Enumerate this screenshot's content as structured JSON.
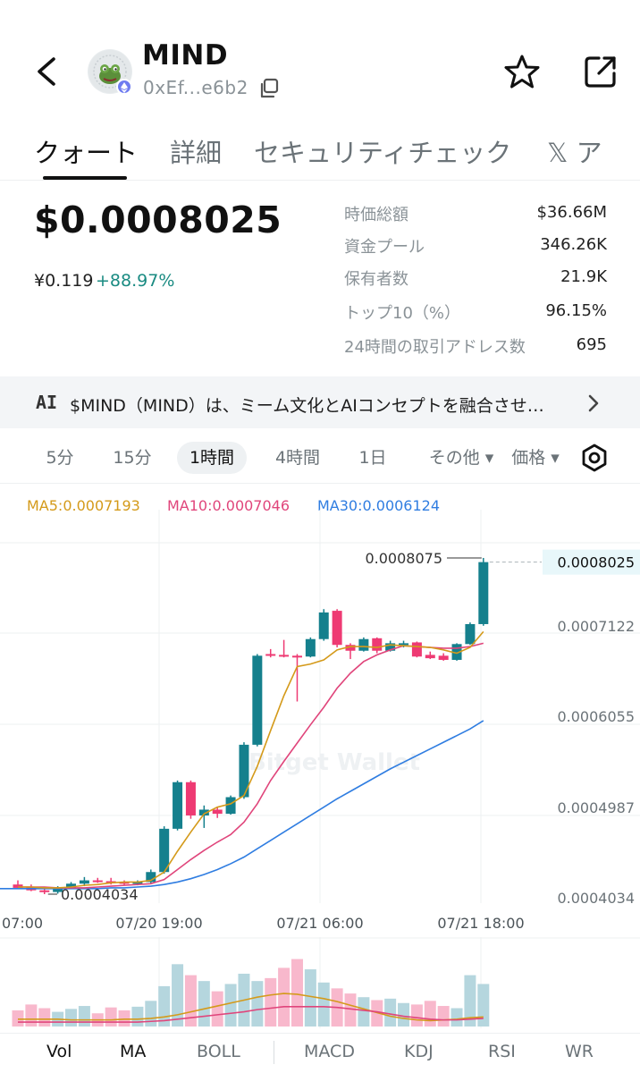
{
  "token": {
    "name": "MIND",
    "address": "0xEf...e6b2"
  },
  "tabs": [
    {
      "label": "クォート",
      "active": true
    },
    {
      "label": "詳細",
      "active": false
    },
    {
      "label": "セキュリティチェック",
      "active": false
    },
    {
      "label": "𝕏 ア",
      "active": false
    }
  ],
  "price": {
    "usd": "$0.0008025",
    "jpy": "¥0.119",
    "change": "+88.97%"
  },
  "stats": [
    {
      "label": "時価総額",
      "value": "$36.66M"
    },
    {
      "label": "資金プール",
      "value": "346.26K"
    },
    {
      "label": "保有者数",
      "value": "21.9K"
    },
    {
      "label": "トップ10（%）",
      "value": "96.15%"
    },
    {
      "label": "24時間の取引アドレス数",
      "value": "695"
    }
  ],
  "ai_banner": {
    "logo": "AI",
    "text": "$MIND（MIND）は、ミーム文化とAIコンセプトを融合させ…"
  },
  "timeframes": [
    {
      "label": "5分",
      "active": false
    },
    {
      "label": "15分",
      "active": false
    },
    {
      "label": "1時間",
      "active": true
    },
    {
      "label": "4時間",
      "active": false
    },
    {
      "label": "1日",
      "active": false
    },
    {
      "label": "その他 ▾",
      "active": false
    },
    {
      "label": "価格 ▾",
      "active": false
    }
  ],
  "ma_legend": {
    "ma5": "MA5:0.0007193",
    "ma10": "MA10:0.0007046",
    "ma30": "MA30:0.0006124"
  },
  "colors": {
    "up": "#15808d",
    "down": "#ee3a73",
    "ma5": "#d49a1a",
    "ma10": "#e0457b",
    "ma30": "#2f7de1",
    "accent_change": "#1a8b82"
  },
  "chart_data": {
    "type": "candlestick",
    "y_ticks": [
      "0.0008025",
      "0.0007122",
      "0.0006055",
      "0.0004987",
      "0.0004034"
    ],
    "x_ticks": [
      "07:00",
      "07/20 19:00",
      "07/21 06:00",
      "07/21 18:00"
    ],
    "high_label": "0.0008075",
    "low_label": "0.0004034",
    "current_price_label": "0.0008025",
    "watermark": "Bitget Wallet",
    "ylim": [
      0.0004034,
      0.0008075
    ],
    "candles": [
      {
        "o": 0.000415,
        "h": 0.00042,
        "l": 0.00041,
        "c": 0.000411
      },
      {
        "o": 0.000412,
        "h": 0.000415,
        "l": 0.000407,
        "c": 0.000408
      },
      {
        "o": 0.000408,
        "h": 0.000412,
        "l": 0.0004034,
        "c": 0.000406
      },
      {
        "o": 0.000406,
        "h": 0.000413,
        "l": 0.000404,
        "c": 0.000411
      },
      {
        "o": 0.000411,
        "h": 0.000418,
        "l": 0.00041,
        "c": 0.000416
      },
      {
        "o": 0.000416,
        "h": 0.000424,
        "l": 0.000413,
        "c": 0.00042
      },
      {
        "o": 0.00042,
        "h": 0.000423,
        "l": 0.000417,
        "c": 0.000419
      },
      {
        "o": 0.000419,
        "h": 0.000423,
        "l": 0.000415,
        "c": 0.000418
      },
      {
        "o": 0.000418,
        "h": 0.00042,
        "l": 0.000414,
        "c": 0.000416
      },
      {
        "o": 0.000416,
        "h": 0.00042,
        "l": 0.000414,
        "c": 0.000418
      },
      {
        "o": 0.000418,
        "h": 0.000433,
        "l": 0.000416,
        "c": 0.00043
      },
      {
        "o": 0.00043,
        "h": 0.000485,
        "l": 0.000428,
        "c": 0.000482
      },
      {
        "o": 0.000482,
        "h": 0.00054,
        "l": 0.00048,
        "c": 0.000538
      },
      {
        "o": 0.000538,
        "h": 0.00054,
        "l": 0.000494,
        "c": 0.000498
      },
      {
        "o": 0.000498,
        "h": 0.00051,
        "l": 0.000483,
        "c": 0.000505
      },
      {
        "o": 0.000505,
        "h": 0.000508,
        "l": 0.000495,
        "c": 0.0005
      },
      {
        "o": 0.0005,
        "h": 0.000522,
        "l": 0.000499,
        "c": 0.00052
      },
      {
        "o": 0.00052,
        "h": 0.000586,
        "l": 0.000518,
        "c": 0.000583
      },
      {
        "o": 0.000583,
        "h": 0.000692,
        "l": 0.000581,
        "c": 0.00069
      },
      {
        "o": 0.000692,
        "h": 0.000698,
        "l": 0.000688,
        "c": 0.000691
      },
      {
        "o": 0.000691,
        "h": 0.000709,
        "l": 0.000688,
        "c": 0.000689
      },
      {
        "o": 0.00069,
        "h": 0.000692,
        "l": 0.000635,
        "c": 0.000689
      },
      {
        "o": 0.000689,
        "h": 0.000712,
        "l": 0.000688,
        "c": 0.00071
      },
      {
        "o": 0.00071,
        "h": 0.000746,
        "l": 0.000708,
        "c": 0.000742
      },
      {
        "o": 0.000744,
        "h": 0.000746,
        "l": 0.0007,
        "c": 0.000703
      },
      {
        "o": 0.000703,
        "h": 0.000705,
        "l": 0.000686,
        "c": 0.000696
      },
      {
        "o": 0.000696,
        "h": 0.000712,
        "l": 0.000695,
        "c": 0.00071
      },
      {
        "o": 0.000711,
        "h": 0.000712,
        "l": 0.000693,
        "c": 0.000696
      },
      {
        "o": 0.000696,
        "h": 0.000708,
        "l": 0.000695,
        "c": 0.000705
      },
      {
        "o": 0.000704,
        "h": 0.000708,
        "l": 0.0007,
        "c": 0.000705
      },
      {
        "o": 0.000706,
        "h": 0.000707,
        "l": 0.000688,
        "c": 0.000689
      },
      {
        "o": 0.000691,
        "h": 0.000695,
        "l": 0.000686,
        "c": 0.000687
      },
      {
        "o": 0.00069,
        "h": 0.000693,
        "l": 0.000684,
        "c": 0.000685
      },
      {
        "o": 0.000685,
        "h": 0.000705,
        "l": 0.000684,
        "c": 0.000704
      },
      {
        "o": 0.000704,
        "h": 0.00073,
        "l": 0.000703,
        "c": 0.000728
      },
      {
        "o": 0.000728,
        "h": 0.0008075,
        "l": 0.000726,
        "c": 0.0008025
      }
    ],
    "ma5": [
      0.000412,
      0.000412,
      0.000411,
      0.000411,
      0.000412,
      0.000414,
      0.000415,
      0.000417,
      0.000418,
      0.000418,
      0.00042,
      0.00043,
      0.000455,
      0.000478,
      0.0005,
      0.000508,
      0.000512,
      0.000522,
      0.000557,
      0.0006,
      0.000642,
      0.000677,
      0.00068,
      0.000685,
      0.000697,
      0.000701,
      0.000701,
      0.0007,
      0.000703,
      0.000702,
      0.000701,
      0.0007,
      0.000697,
      0.000693,
      0.0007,
      0.000719
    ],
    "ma10": [
      0.000412,
      0.000412,
      0.000412,
      0.000411,
      0.000411,
      0.000411,
      0.000412,
      0.000413,
      0.000414,
      0.000415,
      0.000416,
      0.000421,
      0.000433,
      0.000445,
      0.000456,
      0.000466,
      0.000475,
      0.00049,
      0.000512,
      0.00054,
      0.000563,
      0.000585,
      0.000607,
      0.000628,
      0.000651,
      0.000669,
      0.000683,
      0.000691,
      0.000697,
      0.000702,
      0.000701,
      0.0007,
      0.000699,
      0.000699,
      0.000701,
      0.000705
    ],
    "ma30": [
      0.00041,
      0.00041,
      0.00041,
      0.00041,
      0.00041,
      0.00041,
      0.00041,
      0.000411,
      0.000411,
      0.000412,
      0.000413,
      0.000415,
      0.000418,
      0.000422,
      0.000427,
      0.000433,
      0.00044,
      0.000448,
      0.000458,
      0.000468,
      0.000478,
      0.000488,
      0.000498,
      0.000508,
      0.000518,
      0.000527,
      0.000536,
      0.000545,
      0.000554,
      0.000562,
      0.00057,
      0.000578,
      0.000586,
      0.000594,
      0.000602,
      0.000612
    ],
    "volume": [
      0.22,
      0.3,
      0.25,
      0.2,
      0.24,
      0.28,
      0.18,
      0.26,
      0.22,
      0.27,
      0.35,
      0.55,
      0.85,
      0.7,
      0.62,
      0.48,
      0.58,
      0.72,
      0.62,
      0.66,
      0.8,
      0.92,
      0.78,
      0.6,
      0.52,
      0.45,
      0.4,
      0.36,
      0.38,
      0.32,
      0.3,
      0.35,
      0.28,
      0.25,
      0.7,
      0.58
    ],
    "vol_ma1": [
      0.1,
      0.1,
      0.1,
      0.1,
      0.09,
      0.09,
      0.09,
      0.09,
      0.1,
      0.1,
      0.11,
      0.13,
      0.16,
      0.2,
      0.24,
      0.28,
      0.32,
      0.36,
      0.4,
      0.43,
      0.45,
      0.44,
      0.41,
      0.38,
      0.34,
      0.29,
      0.24,
      0.19,
      0.14,
      0.11,
      0.09,
      0.08,
      0.09,
      0.1,
      0.12,
      0.13
    ],
    "vol_ma2": [
      0.06,
      0.06,
      0.06,
      0.06,
      0.06,
      0.06,
      0.06,
      0.06,
      0.06,
      0.06,
      0.07,
      0.08,
      0.1,
      0.12,
      0.14,
      0.16,
      0.18,
      0.2,
      0.23,
      0.25,
      0.27,
      0.27,
      0.27,
      0.27,
      0.26,
      0.24,
      0.22,
      0.2,
      0.17,
      0.14,
      0.12,
      0.1,
      0.09,
      0.09,
      0.1,
      0.11
    ]
  },
  "indicators": [
    {
      "label": "Vol",
      "active": true
    },
    {
      "label": "MA",
      "active": true
    },
    {
      "label": "BOLL",
      "active": false
    },
    {
      "label": "MACD",
      "active": false
    },
    {
      "label": "KDJ",
      "active": false
    },
    {
      "label": "RSI",
      "active": false
    },
    {
      "label": "WR",
      "active": false
    }
  ]
}
